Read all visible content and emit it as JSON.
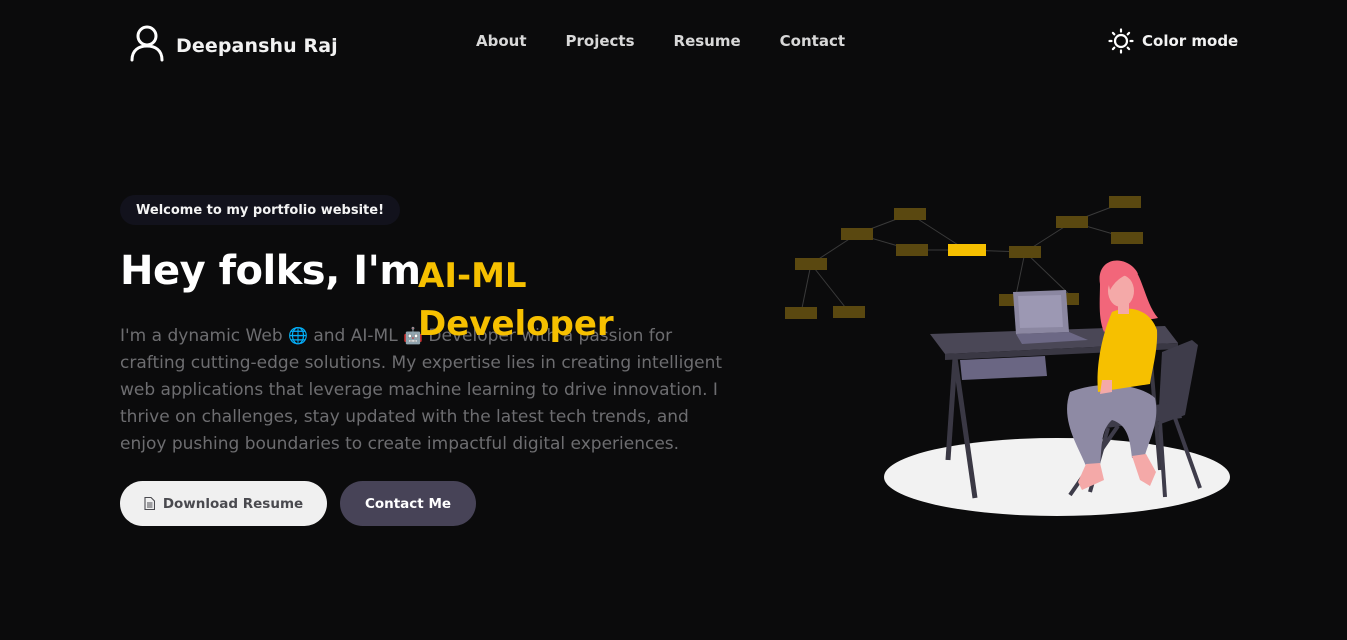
{
  "header": {
    "logo_icon": "user-icon",
    "name": "Deepanshu Raj",
    "nav": [
      {
        "label": "About"
      },
      {
        "label": "Projects"
      },
      {
        "label": "Resume"
      },
      {
        "label": "Contact"
      }
    ],
    "color_mode_icon": "sun-icon",
    "color_mode_label": "Color mode"
  },
  "hero": {
    "badge": "Welcome to my portfolio website!",
    "headline": "Hey folks, I'm",
    "role": "AI-ML Developer",
    "intro": {
      "part1": "I'm a dynamic Web",
      "emoji_web": "🌐",
      "part2": "and AI-ML",
      "emoji_robot": "🤖",
      "part3": "Developer with a passion for crafting cutting-edge solutions. My expertise lies in creating intelligent web applications that leverage machine learning to drive innovation. I thrive on challenges, stay updated with the latest tech trends, and enjoy pushing boundaries to create impactful digital experiences."
    },
    "buttons": {
      "resume_icon": "document-icon",
      "resume_label": "Download Resume",
      "contact_label": "Contact Me"
    }
  },
  "colors": {
    "background": "#0b0b0c",
    "accent": "#f6c000",
    "text_primary": "#ffffff",
    "text_muted": "#6d6d70",
    "button_light": "#f0f0f0",
    "button_dark": "#474357"
  }
}
